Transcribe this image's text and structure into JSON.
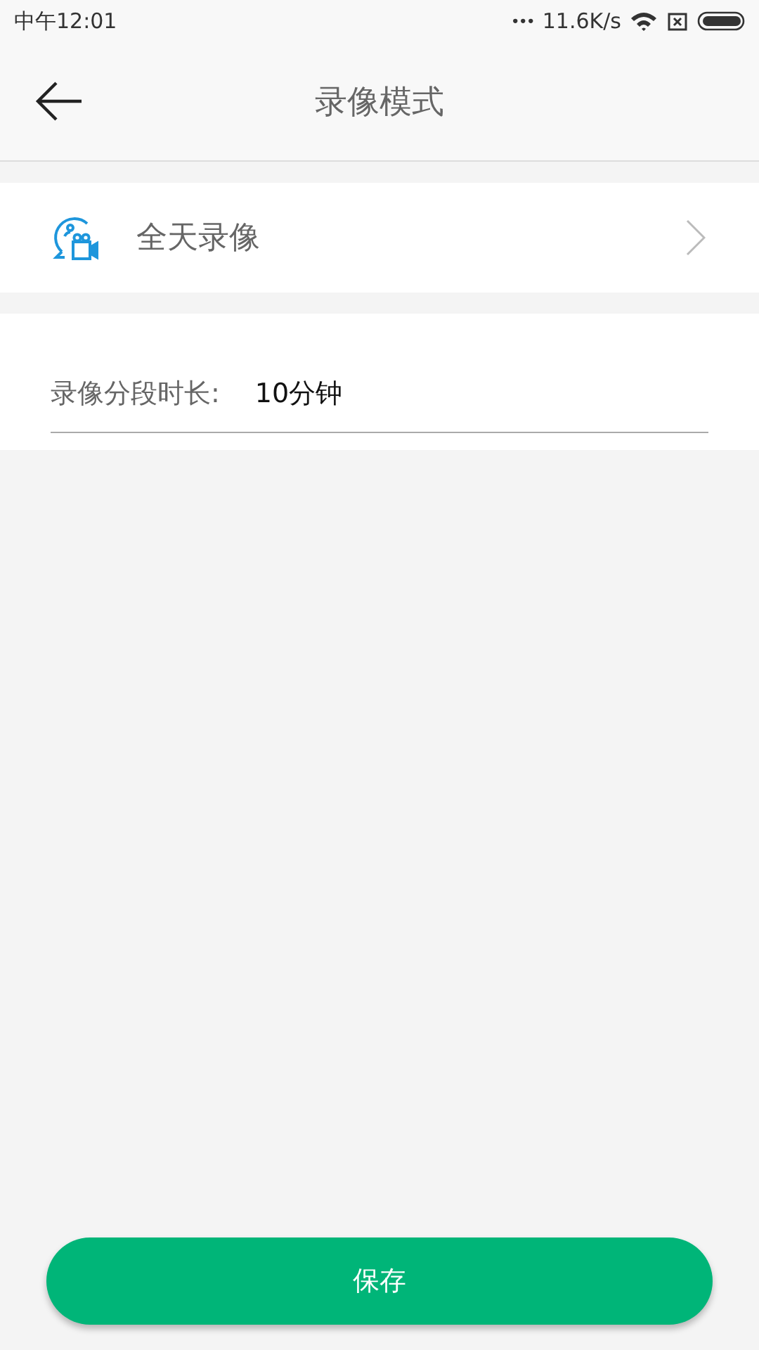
{
  "status_bar": {
    "time": "中午12:01",
    "dots": "•••",
    "speed": "11.6K/s"
  },
  "header": {
    "title": "录像模式"
  },
  "mode_row": {
    "label": "全天录像"
  },
  "segment": {
    "label": "录像分段时长:",
    "value": "10分钟"
  },
  "save_button": {
    "label": "保存"
  }
}
